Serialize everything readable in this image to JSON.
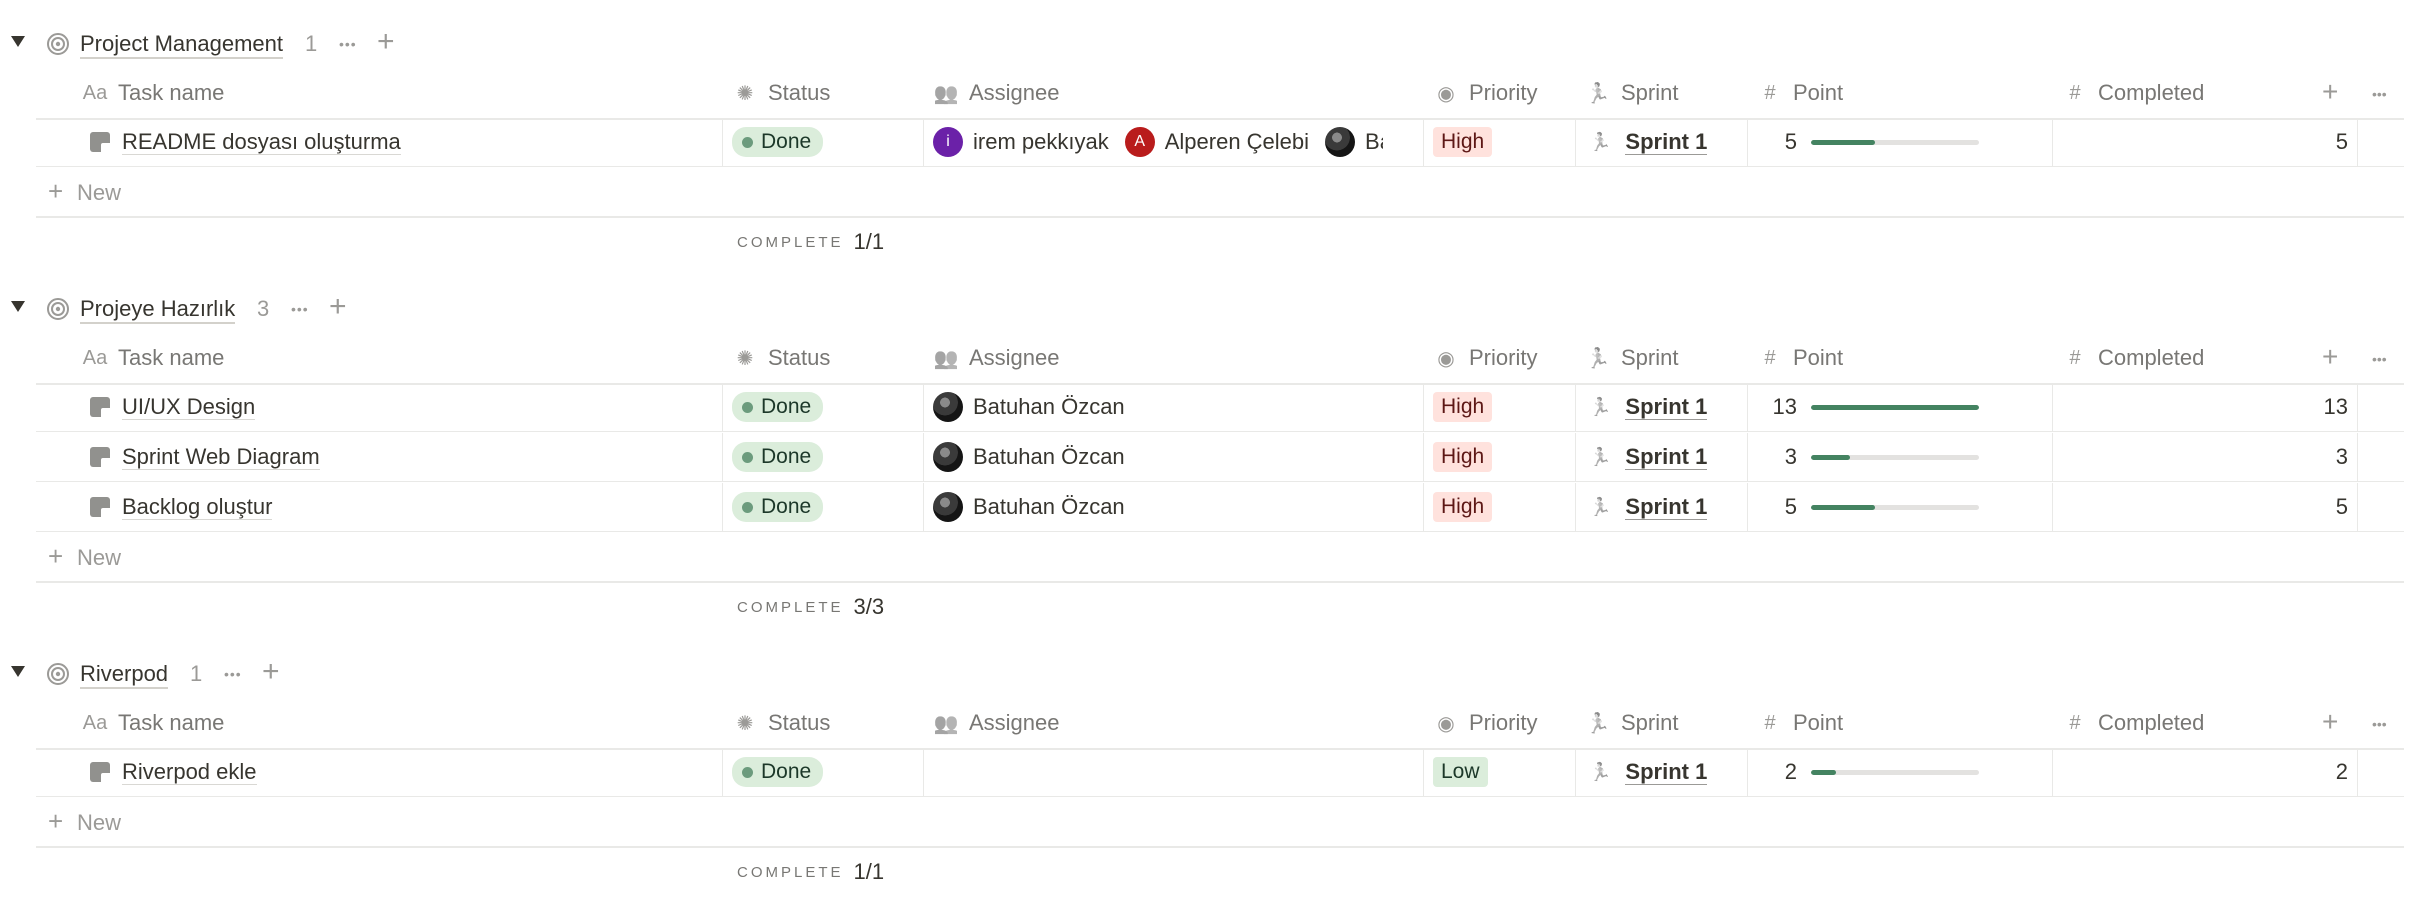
{
  "columns": {
    "task_name": "Task name",
    "status": "Status",
    "assignee": "Assignee",
    "priority": "Priority",
    "sprint": "Sprint",
    "point": "Point",
    "completed": "Completed"
  },
  "new_label": "New",
  "calc_label": "COMPLETE",
  "groups": [
    {
      "title": "Project Management",
      "count": "1",
      "calc_value": "1/1",
      "rows": [
        {
          "name": "README dosyası oluşturma",
          "status": "Done",
          "assignees": [
            {
              "name": "irem pekkıyak",
              "initial": "i",
              "color": "#6b21a8"
            },
            {
              "name": "Alperen Çelebi",
              "initial": "A",
              "color": "#b91c1c"
            },
            {
              "name": "Batuh",
              "initial": "",
              "color": "#2b2b2b"
            }
          ],
          "priority": "High",
          "sprint": "Sprint 1",
          "point": "5",
          "progress": 0.38,
          "completed": "5"
        }
      ]
    },
    {
      "title": "Projeye Hazırlık",
      "count": "3",
      "calc_value": "3/3",
      "rows": [
        {
          "name": "UI/UX Design",
          "status": "Done",
          "assignees": [
            {
              "name": "Batuhan Özcan",
              "initial": "",
              "color": "#2b2b2b"
            }
          ],
          "priority": "High",
          "sprint": "Sprint 1",
          "point": "13",
          "progress": 1.0,
          "completed": "13"
        },
        {
          "name": "Sprint Web Diagram",
          "status": "Done",
          "assignees": [
            {
              "name": "Batuhan Özcan",
              "initial": "",
              "color": "#2b2b2b"
            }
          ],
          "priority": "High",
          "sprint": "Sprint 1",
          "point": "3",
          "progress": 0.23,
          "completed": "3"
        },
        {
          "name": "Backlog oluştur",
          "status": "Done",
          "assignees": [
            {
              "name": "Batuhan Özcan",
              "initial": "",
              "color": "#2b2b2b"
            }
          ],
          "priority": "High",
          "sprint": "Sprint 1",
          "point": "5",
          "progress": 0.38,
          "completed": "5"
        }
      ]
    },
    {
      "title": "Riverpod",
      "count": "1",
      "calc_value": "1/1",
      "rows": [
        {
          "name": "Riverpod ekle",
          "status": "Done",
          "assignees": [],
          "priority": "Low",
          "sprint": "Sprint 1",
          "point": "2",
          "progress": 0.15,
          "completed": "2"
        }
      ]
    }
  ]
}
